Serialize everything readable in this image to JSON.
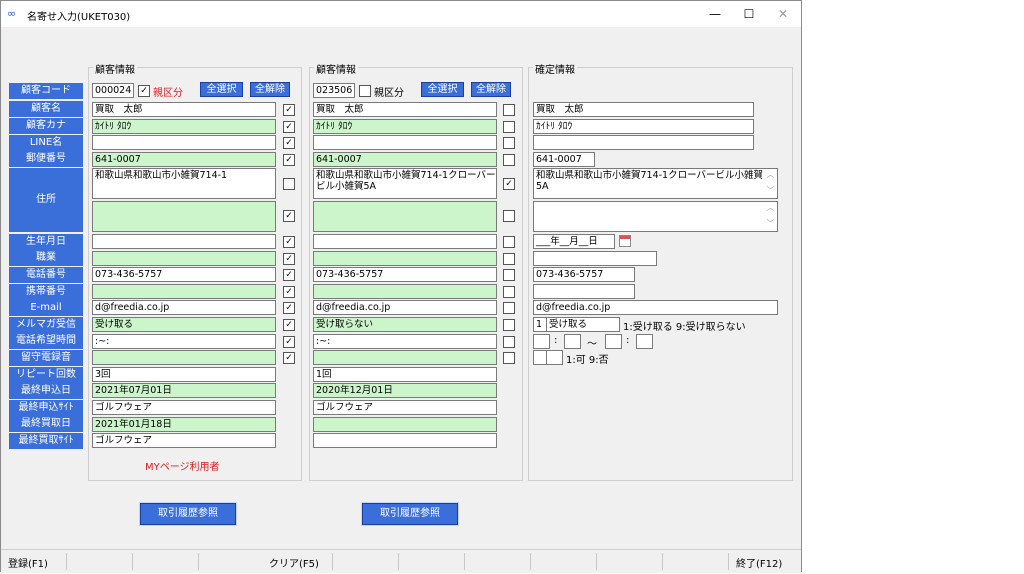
{
  "window": {
    "title": "名寄せ入力(UKET030)",
    "minimize": "—",
    "maximize": "☐",
    "close": "✕"
  },
  "labels": [
    "顧客コード",
    "顧客名",
    "顧客カナ",
    "LINE名",
    "郵便番号",
    "住所",
    "生年月日",
    "職業",
    "電話番号",
    "携帯番号",
    "E-mail",
    "メルマガ受信",
    "電話希望時間",
    "留守電録音",
    "リピート回数",
    "最終申込日",
    "最終申込ｻｲﾄ",
    "最終買取日",
    "最終買取ｻｲﾄ"
  ],
  "left": {
    "group_title": "顧客情報",
    "code": "000024",
    "oyakubun": "親区分",
    "select_all": "全選択",
    "deselect_all": "全解除",
    "name": "買取　太郎",
    "kana": "ｶｲﾄﾘ ﾀﾛｳ",
    "line": "",
    "zip": "641-0007",
    "address1": "和歌山県和歌山市小雑賀714-1",
    "address2": "",
    "birthday": "",
    "job": "",
    "phone": "073-436-5757",
    "mobile": "",
    "email": "d@freedia.co.jp",
    "mailmag": "受け取る",
    "call_time": ":~:",
    "answering": "",
    "repeat": "3回",
    "last_apply_date": "2021年07月01日",
    "last_apply_site": "ゴルフウェア",
    "last_buy_date": "2021年01月18日",
    "last_buy_site": "ゴルフウェア",
    "mypage": "MYページ利用者",
    "history_button": "取引履歴参照"
  },
  "middle": {
    "group_title": "顧客情報",
    "code": "023506",
    "oyakubun": "親区分",
    "select_all": "全選択",
    "deselect_all": "全解除",
    "name": "買取　太郎",
    "kana": "ｶｲﾄﾘ ﾀﾛｳ",
    "line": "",
    "zip": "641-0007",
    "address1": "和歌山県和歌山市小雑賀714-1クローバービル小雑賀5A",
    "address2": "",
    "birthday": "",
    "job": "",
    "phone": "073-436-5757",
    "mobile": "",
    "email": "d@freedia.co.jp",
    "mailmag": "受け取らない",
    "call_time": ":~:",
    "answering": "",
    "repeat": "1回",
    "last_apply_date": "2020年12月01日",
    "last_apply_site": "ゴルフウェア",
    "last_buy_date": "",
    "last_buy_site": "",
    "history_button": "取引履歴参照"
  },
  "right": {
    "group_title": "確定情報",
    "name": "買取　太郎",
    "kana": "ｶｲﾄﾘ ﾀﾛｳ",
    "line": "",
    "zip": "641-0007",
    "address1": "和歌山県和歌山市小雑賀714-1クローバービル小雑賀5A",
    "address2": "",
    "birthday": "___年__月__日",
    "job": "",
    "phone": "073-436-5757",
    "mobile": "",
    "email": "d@freedia.co.jp",
    "mailmag_code": "1",
    "mailmag_text": "受け取る",
    "mailmag_hint": "1:受け取る 9:受け取らない",
    "colon1": ":",
    "tilde": "～",
    "colon2": ":",
    "answer_hint": "1:可 9:否"
  },
  "status": {
    "f1": "登録(F1)",
    "f5": "クリア(F5)",
    "f12": "終了(F12)"
  },
  "checks": {
    "left": [
      true,
      true,
      true,
      true,
      false,
      true,
      true,
      true,
      true,
      true,
      true,
      true,
      true,
      true
    ],
    "middle": [
      false,
      false,
      false,
      false,
      true,
      false,
      false,
      false,
      false,
      false,
      false,
      false,
      false,
      false
    ],
    "left_oya": true,
    "middle_oya": false
  }
}
